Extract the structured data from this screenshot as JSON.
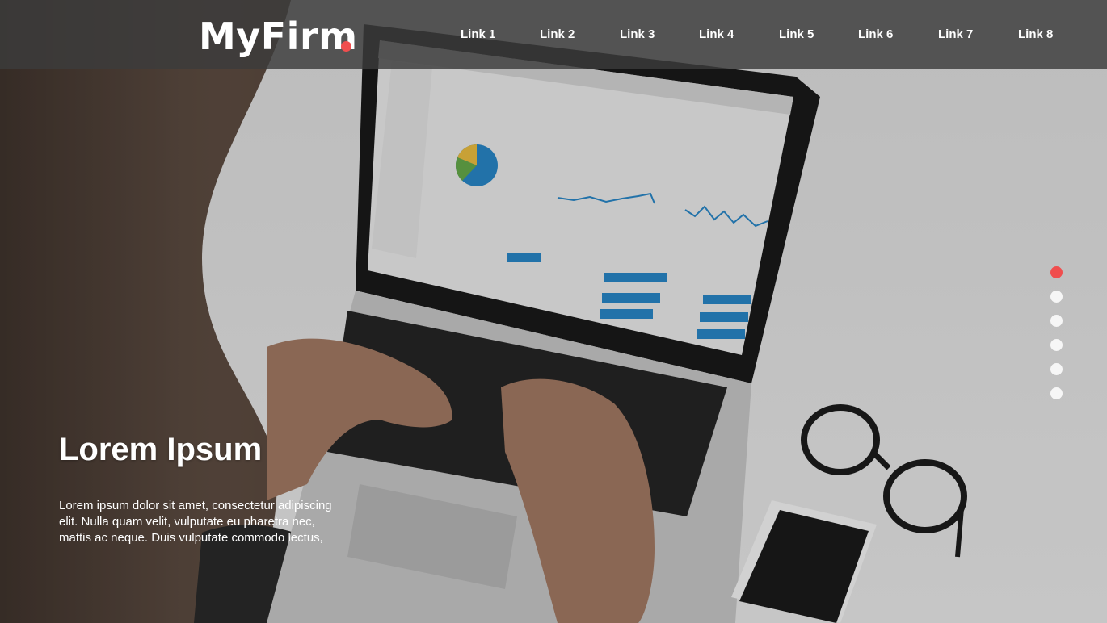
{
  "brand": {
    "name": "MyFirm",
    "dot_color": "#f04e4e"
  },
  "nav": {
    "links": [
      "Link 1",
      "Link 2",
      "Link 3",
      "Link 4",
      "Link 5",
      "Link 6",
      "Link 7",
      "Link 8"
    ]
  },
  "hero": {
    "title": "Lorem Ipsum",
    "body": "Lorem ipsum dolor sit amet, consectetur adipiscing elit. Nulla quam velit, vulputate eu pharetra nec, mattis ac neque. Duis vulputate commodo lectus,"
  },
  "slider": {
    "total": 6,
    "active_index": 0,
    "active_color": "#f04e4e"
  }
}
